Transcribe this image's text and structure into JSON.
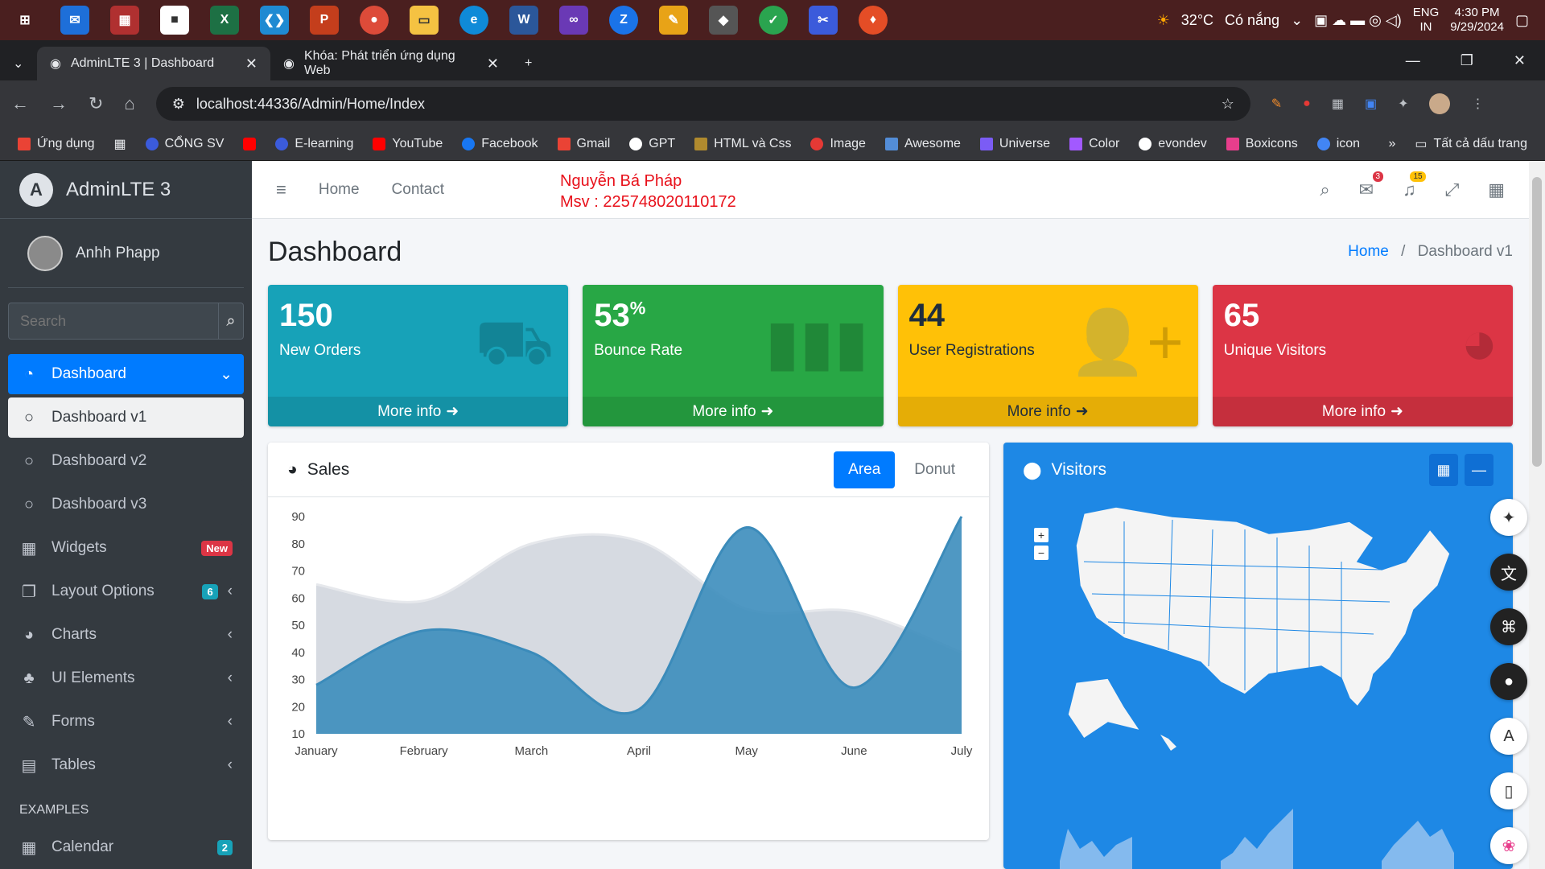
{
  "taskbar": {
    "weather": "32°C",
    "weather_desc": "Có nắng",
    "lang": "ENG",
    "lang2": "IN",
    "time": "4:30 PM",
    "date": "9/29/2024"
  },
  "browser": {
    "tabs": [
      {
        "label": "AdminLTE 3 | Dashboard"
      },
      {
        "label": "Khóa: Phát triển ứng dụng Web"
      }
    ],
    "url": "localhost:44336/Admin/Home/Index",
    "bookmarks": [
      "Ứng dụng",
      "CỔNG SV",
      "E-learning",
      "YouTube",
      "Facebook",
      "Gmail",
      "GPT",
      "HTML và Css",
      "Image",
      "Awesome",
      "Universe",
      "Color",
      "evondev",
      "Boxicons",
      "icon"
    ],
    "all_bookmarks": "Tất cả dấu trang"
  },
  "sidebar": {
    "brand": "AdminLTE 3",
    "brand_logo": "A",
    "user": "Anhh Phapp",
    "search_placeholder": "Search",
    "items": [
      {
        "label": "Dashboard",
        "icon": "tachometer-icon"
      },
      {
        "label": "Dashboard v1"
      },
      {
        "label": "Dashboard v2"
      },
      {
        "label": "Dashboard v3"
      },
      {
        "label": "Widgets",
        "badge": "New"
      },
      {
        "label": "Layout Options",
        "badge": "6"
      },
      {
        "label": "Charts"
      },
      {
        "label": "UI Elements"
      },
      {
        "label": "Forms"
      },
      {
        "label": "Tables"
      }
    ],
    "examples_header": "EXAMPLES",
    "calendar": {
      "label": "Calendar",
      "badge": "2"
    }
  },
  "navbar": {
    "home": "Home",
    "contact": "Contact",
    "student_name": "Nguyễn Bá Pháp",
    "student_id": "Msv : 225748020110172",
    "messages_badge": "3",
    "notif_badge": "15"
  },
  "header": {
    "title": "Dashboard",
    "crumb_home": "Home",
    "crumb_sep": "/",
    "crumb_current": "Dashboard v1"
  },
  "boxes": [
    {
      "value": "150",
      "label": "New Orders",
      "more": "More info",
      "color": "#17a2b8"
    },
    {
      "value": "53",
      "suffix": "%",
      "label": "Bounce Rate",
      "more": "More info",
      "color": "#28a745"
    },
    {
      "value": "44",
      "label": "User Registrations",
      "more": "More info",
      "color": "#ffc107"
    },
    {
      "value": "65",
      "label": "Unique Visitors",
      "more": "More info",
      "color": "#dc3545"
    }
  ],
  "sales": {
    "title": "Sales",
    "tab_area": "Area",
    "tab_donut": "Donut"
  },
  "visitors": {
    "title": "Visitors"
  },
  "chart_data": {
    "type": "area",
    "categories": [
      "January",
      "February",
      "March",
      "April",
      "May",
      "June",
      "July"
    ],
    "series": [
      {
        "values": [
          65,
          59,
          80,
          81,
          56,
          55,
          40
        ],
        "color": "#d2d6de"
      },
      {
        "values": [
          28,
          48,
          40,
          19,
          86,
          27,
          90
        ],
        "color": "#3c8dbc"
      }
    ],
    "ylim": [
      10,
      90
    ],
    "yticks": [
      10,
      20,
      30,
      40,
      50,
      60,
      70,
      80,
      90
    ]
  }
}
